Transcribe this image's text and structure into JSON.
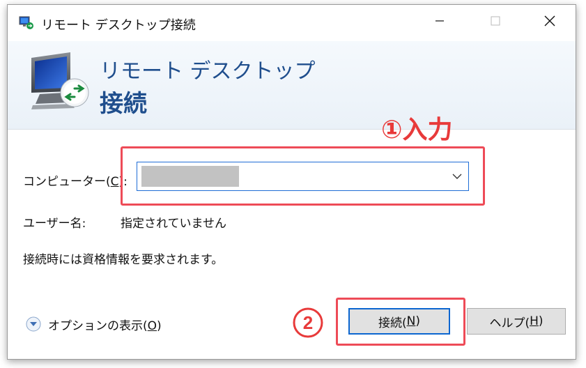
{
  "window": {
    "title": "リモート デスクトップ接続",
    "controls": {
      "minimize": "minimize",
      "maximize": "maximize",
      "close": "close"
    }
  },
  "banner": {
    "line1": "リモート デスクトップ",
    "line2": "接続"
  },
  "annotations": {
    "step1": "①入力",
    "step2": "2",
    "highlight_color": "#ee4b57",
    "step1_color": "#e83a3a"
  },
  "form": {
    "computer_label_prefix": "コンピューター(",
    "computer_label_accel": "C",
    "computer_label_suffix": "):",
    "computer_value": "",
    "user_label": "ユーザー名:",
    "user_value": "指定されていません",
    "credential_note": "接続時には資格情報を要求されます。"
  },
  "options": {
    "label_prefix": "オプションの表示(",
    "label_accel": "O",
    "label_suffix": ")",
    "icon": "chevron-down-circle-icon"
  },
  "buttons": {
    "connect_prefix": "接続(",
    "connect_accel": "N",
    "connect_suffix": ")",
    "help_prefix": "ヘルプ(",
    "help_accel": "H",
    "help_suffix": ")"
  },
  "colors": {
    "banner_text": "#1f4e8d",
    "focus_border": "#0b66d0",
    "button_bg": "#e1e1e1"
  }
}
